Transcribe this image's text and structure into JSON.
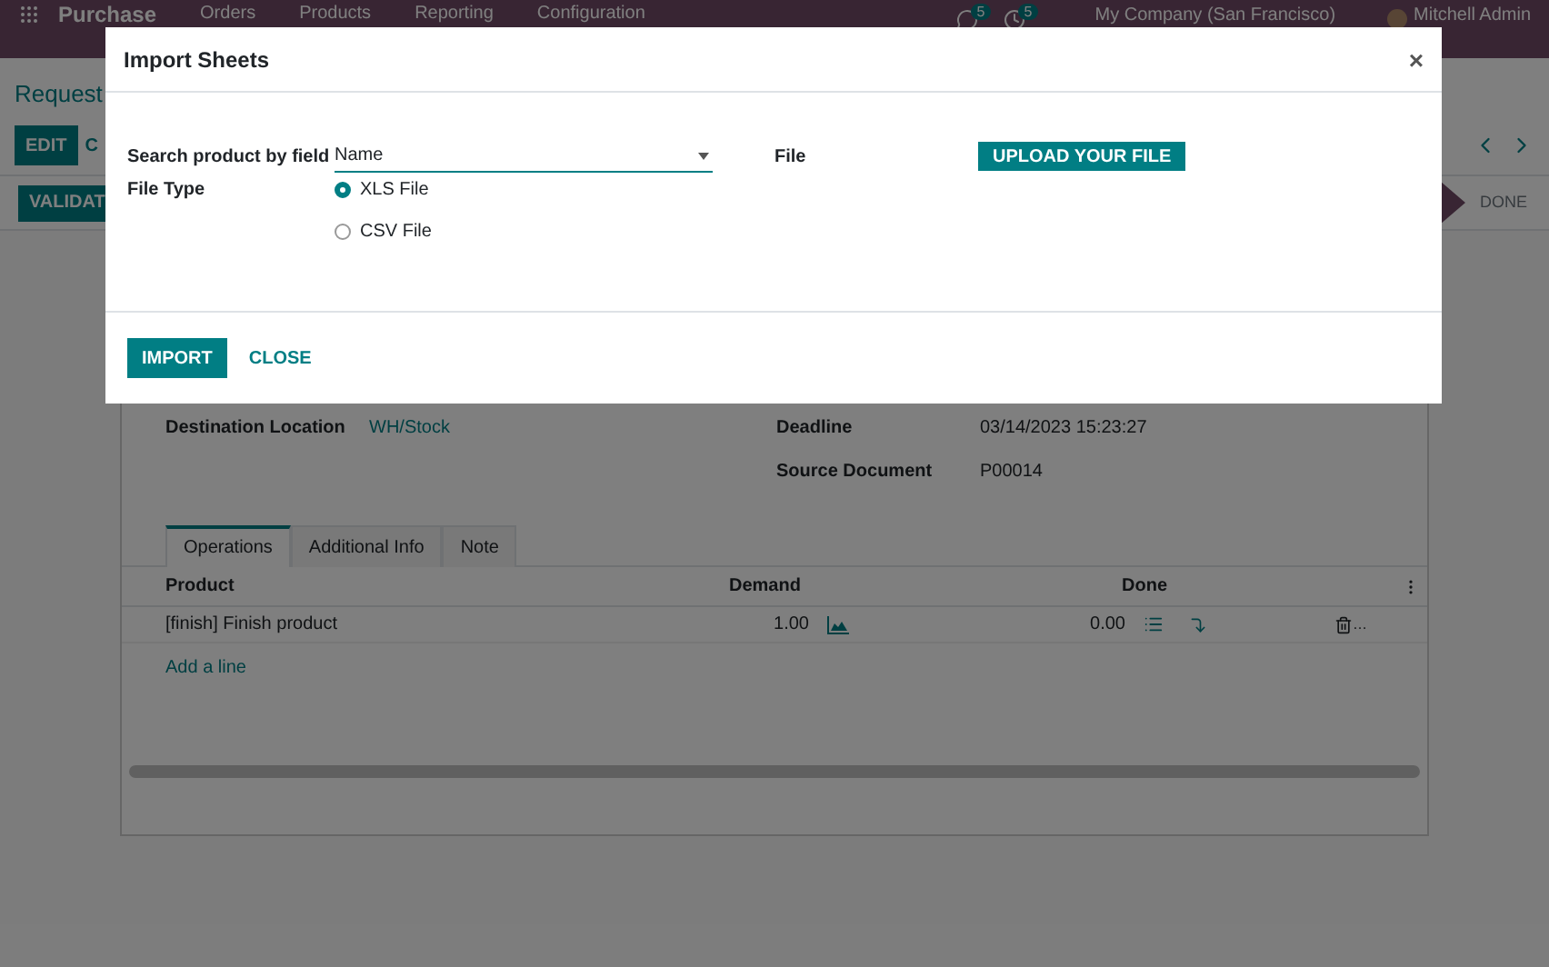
{
  "navbar": {
    "app_name": "Purchase",
    "menu": [
      "Orders",
      "Products",
      "Reporting",
      "Configuration"
    ],
    "messages_badge": "5",
    "activities_badge": "5",
    "company": "My Company (San Francisco)",
    "user": "Mitchell Admin"
  },
  "breadcrumb": "Request",
  "actions": {
    "edit": "EDIT",
    "create": "C"
  },
  "statusbar": {
    "validate": "VALIDAT",
    "steps": [
      {
        "selected": true
      },
      {
        "label": "DONE",
        "selected": false
      }
    ]
  },
  "form": {
    "left_fields": [
      {
        "label": "Destination Location",
        "value": "WH/Stock",
        "kind": "link"
      }
    ],
    "right_fields": [
      {
        "label": "Deadline",
        "value": "03/14/2023 15:23:27",
        "kind": "text"
      },
      {
        "label": "Source Document",
        "value": "P00014",
        "kind": "text"
      }
    ],
    "tabs": [
      {
        "label": "Operations",
        "selected": true
      },
      {
        "label": "Additional Info",
        "selected": false
      },
      {
        "label": "Note",
        "selected": false
      }
    ],
    "table": {
      "columns": [
        "Product",
        "Demand",
        "Done"
      ],
      "rows": [
        {
          "product": "[finish] Finish product",
          "demand": "1.00",
          "done": "0.00",
          "delete_more": "…"
        }
      ],
      "add_line": "Add a line"
    }
  },
  "modal": {
    "title": "Import Sheets",
    "close": "×",
    "search_label": "Search product by field",
    "search_value": "Name",
    "file_label": "File",
    "upload": "UPLOAD YOUR FILE",
    "file_type_label": "File Type",
    "file_types": [
      {
        "label": "XLS File",
        "selected": true
      },
      {
        "label": "CSV File",
        "selected": false
      }
    ],
    "import": "IMPORT",
    "cancel": "CLOSE"
  }
}
